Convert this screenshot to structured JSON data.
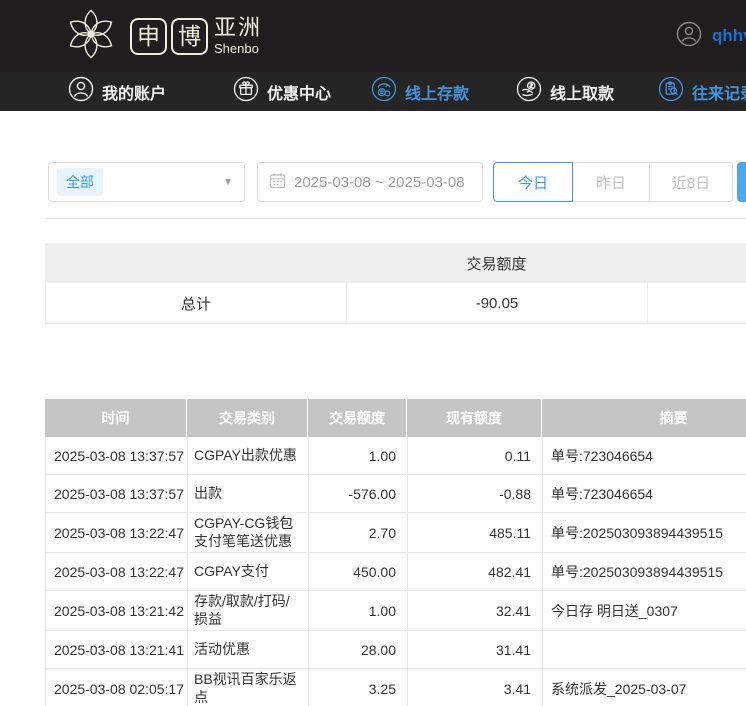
{
  "brand": {
    "logo_char_1": "申",
    "logo_char_2": "博",
    "logo_region": "亚洲",
    "logo_sub": "Shenbo",
    "logo_icon": "flower-icon"
  },
  "user": {
    "name": "qhhv",
    "avatar_icon": "user-circle-icon"
  },
  "nav": {
    "items": [
      {
        "label": "我的账户",
        "icon": "account-icon",
        "active": false
      },
      {
        "label": "优惠中心",
        "icon": "gift-icon",
        "active": false
      },
      {
        "label": "线上存款",
        "icon": "deposit-icon",
        "active": true
      },
      {
        "label": "线上取款",
        "icon": "withdraw-icon",
        "active": false
      },
      {
        "label": "往来记录",
        "icon": "records-icon",
        "active": true
      }
    ]
  },
  "filters": {
    "category_selected": "全部",
    "dropdown_icon": "caret-down-icon",
    "calendar_icon": "calendar-icon",
    "date_range": "2025-03-08 ~ 2025-03-08",
    "quick_buttons": [
      {
        "label": "今日",
        "active": true
      },
      {
        "label": "昨日",
        "active": false
      },
      {
        "label": "近8日",
        "active": false
      }
    ]
  },
  "summary": {
    "column_header": "交易额度",
    "total_label": "总计",
    "total_value": "-90.05"
  },
  "transactions": {
    "columns": [
      "时间",
      "交易类别",
      "交易额度",
      "现有额度",
      "摘要"
    ],
    "rows": [
      {
        "time": "2025-03-08 13:37:57",
        "type": "CGPAY出款优惠",
        "amount": "1.00",
        "balance": "0.11",
        "note": "单号:723046654"
      },
      {
        "time": "2025-03-08 13:37:57",
        "type": "出款",
        "amount": "-576.00",
        "balance": "-0.88",
        "note": "单号:723046654"
      },
      {
        "time": "2025-03-08 13:22:47",
        "type": "CGPAY-CG钱包支付笔笔送优惠",
        "amount": "2.70",
        "balance": "485.11",
        "note": "单号:202503093894439515"
      },
      {
        "time": "2025-03-08 13:22:47",
        "type": "CGPAY支付",
        "amount": "450.00",
        "balance": "482.41",
        "note": "单号:202503093894439515"
      },
      {
        "time": "2025-03-08 13:21:42",
        "type": "存款/取款/打码/损益",
        "amount": "1.00",
        "balance": "32.41",
        "note": "今日存 明日送_0307"
      },
      {
        "time": "2025-03-08 13:21:41",
        "type": "活动优惠",
        "amount": "28.00",
        "balance": "31.41",
        "note": ""
      },
      {
        "time": "2025-03-08 02:05:17",
        "type": "BB视讯百家乐返点",
        "amount": "3.25",
        "balance": "3.41",
        "note": "系统派发_2025-03-07"
      }
    ]
  },
  "colors": {
    "header_bg": "#1f1d1d",
    "nav_bg": "#262525",
    "logo_cream": "#efecdb",
    "nav_active_blue": "#4193dc",
    "username_blue": "#1a6fd8",
    "accent_blue": "#3d9aea",
    "search_button_blue": "#49a9ee",
    "table_header_gray": "#c5c5c5",
    "summary_header_gray": "#efefef"
  }
}
